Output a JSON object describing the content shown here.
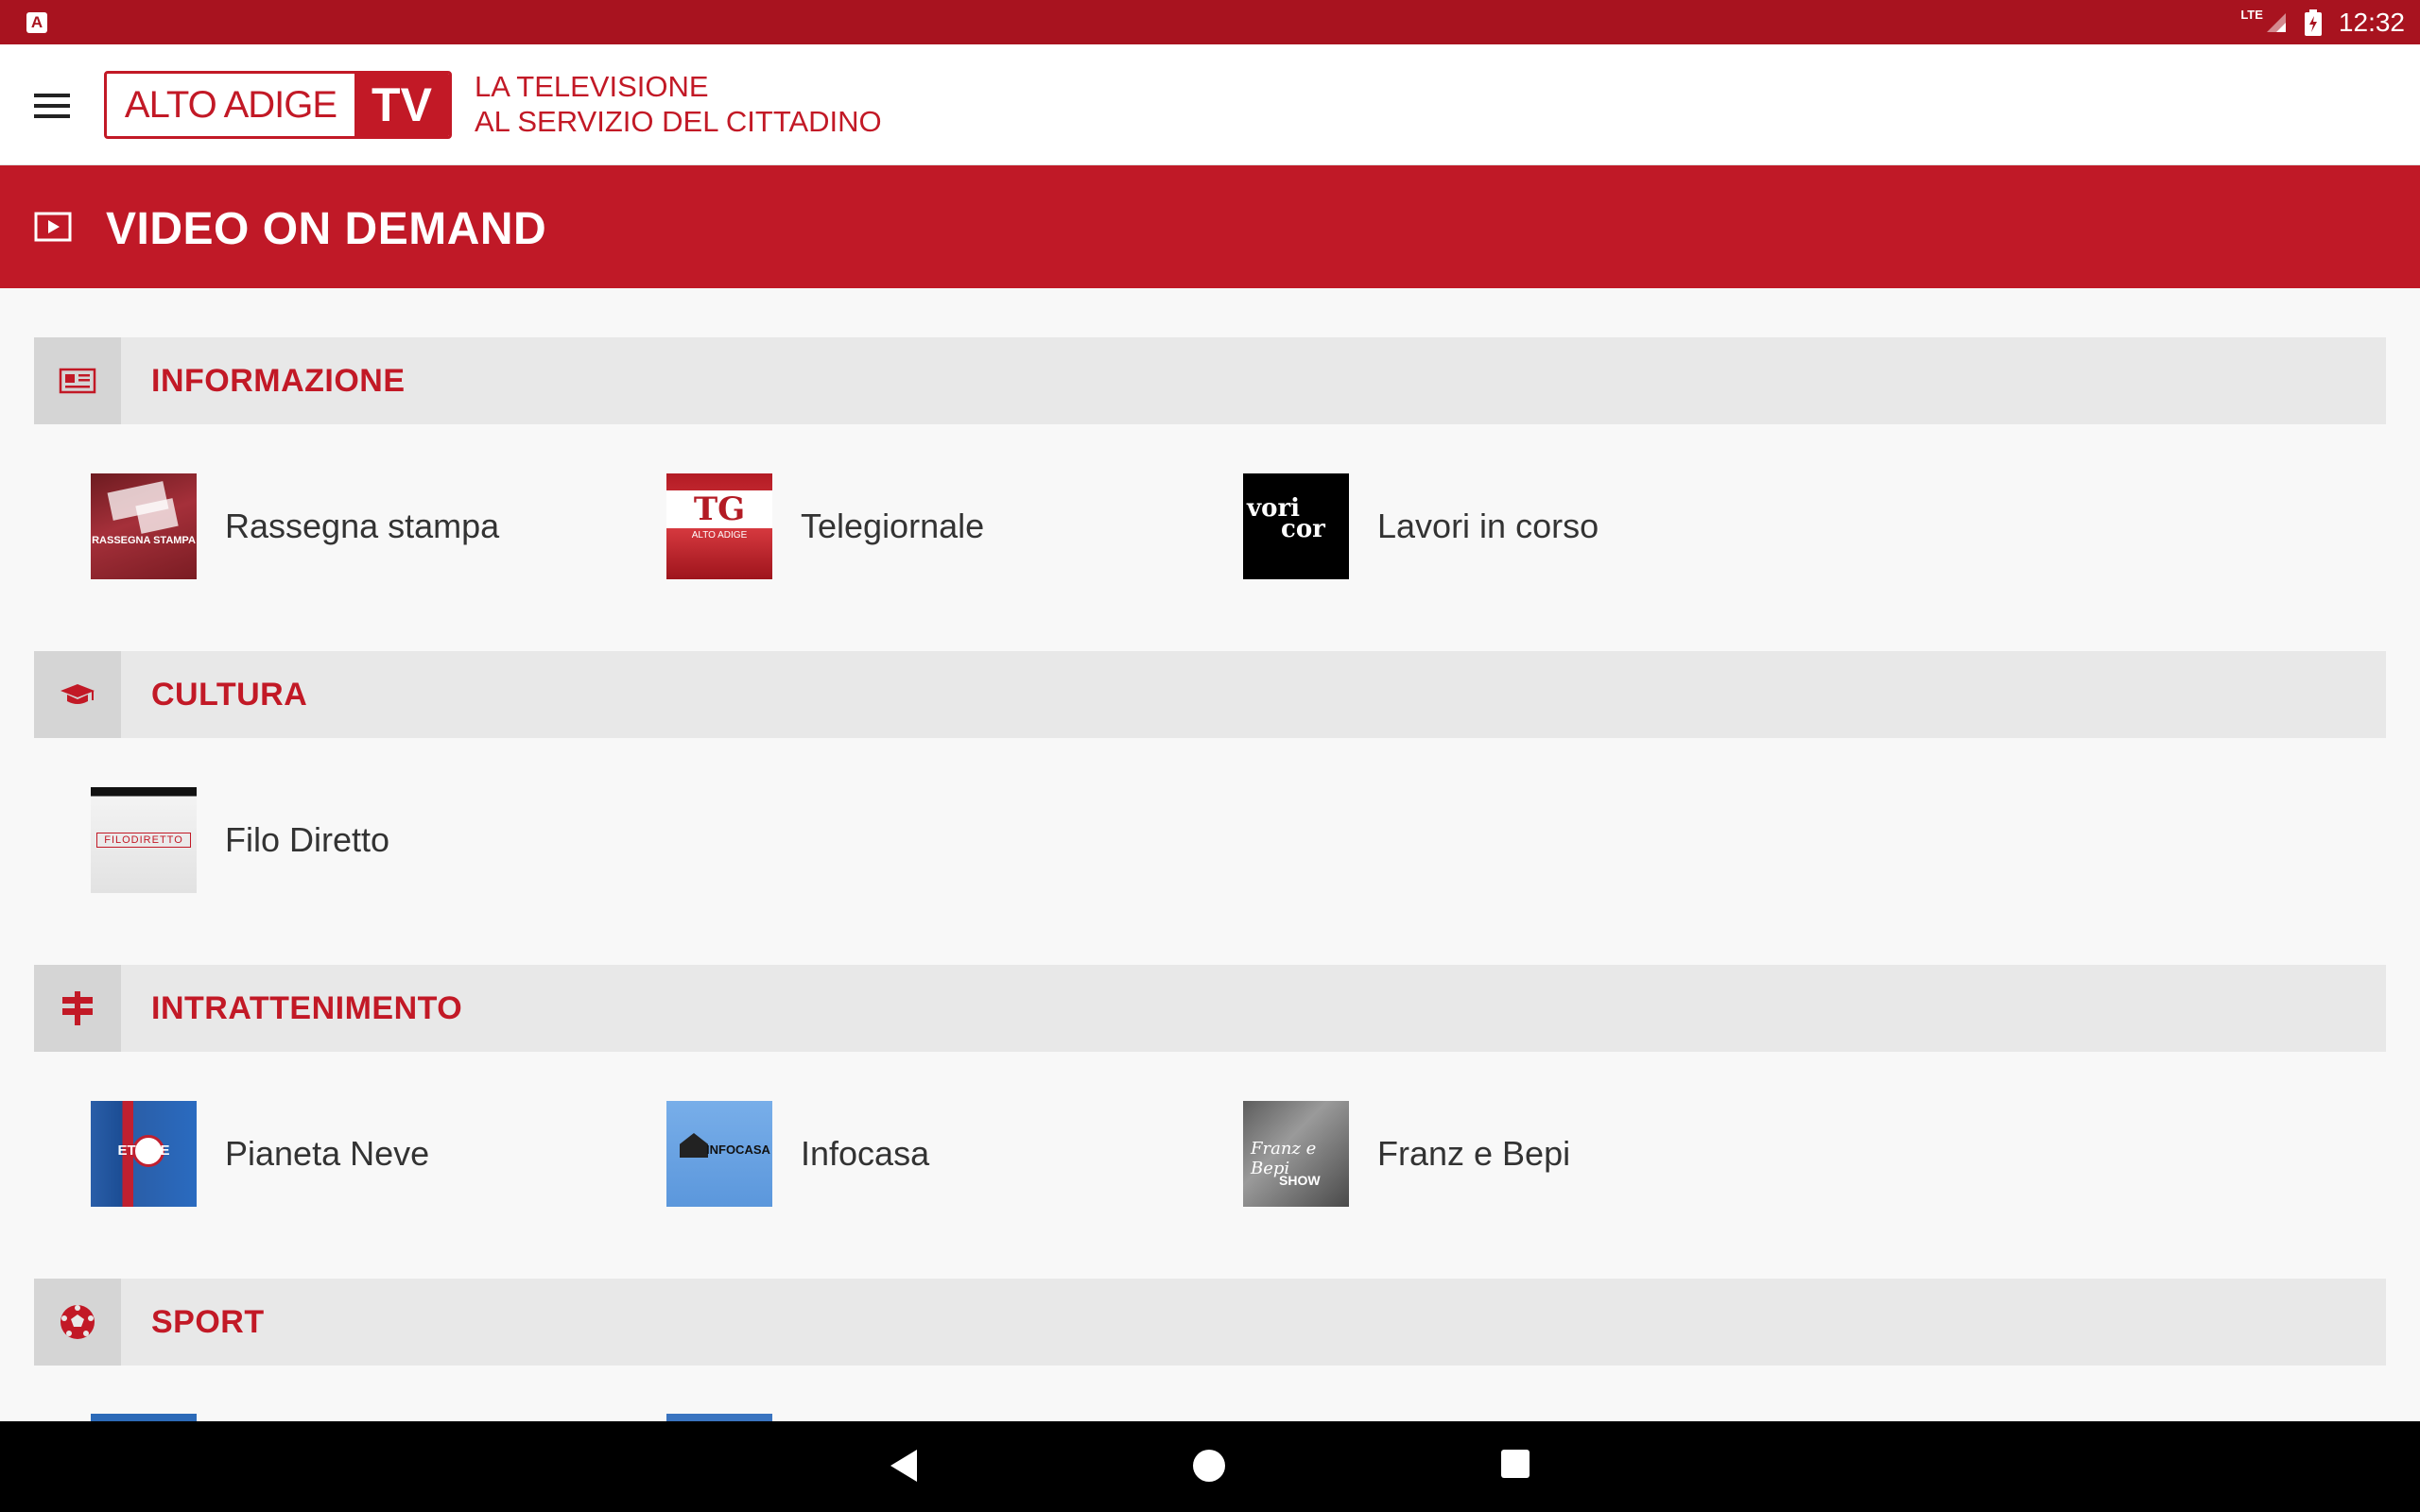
{
  "status_bar": {
    "network": "LTE",
    "time": "12:32"
  },
  "header": {
    "logo_left": "ALTO ADIGE",
    "logo_right": "TV",
    "tagline_line1": "LA TELEVISIONE",
    "tagline_line2": "AL SERVIZIO DEL CITTADINO"
  },
  "page": {
    "title": "VIDEO ON DEMAND"
  },
  "sections": [
    {
      "title": "INFORMAZIONE",
      "icon": "newspaper-icon",
      "items": [
        {
          "label": "Rassegna stampa",
          "thumb_text": "RASSEGNA STAMPA"
        },
        {
          "label": "Telegiornale",
          "thumb_text": "TG",
          "thumb_sub": "ALTO ADIGE"
        },
        {
          "label": "Lavori in corso",
          "thumb_text_1": "vori",
          "thumb_text_2": "cor"
        }
      ]
    },
    {
      "title": "CULTURA",
      "icon": "graduation-cap-icon",
      "items": [
        {
          "label": "Filo Diretto",
          "thumb_text": "FILODIRETTO"
        }
      ]
    },
    {
      "title": "INTRATTENIMENTO",
      "icon": "signpost-icon",
      "items": [
        {
          "label": "Pianeta Neve",
          "thumb_text": "ETR     NE"
        },
        {
          "label": "Infocasa",
          "thumb_text": "INFOCASA"
        },
        {
          "label": "Franz e Bepi",
          "thumb_text_1": "Franz e Bepi",
          "thumb_text_2": "SHOW"
        }
      ]
    },
    {
      "title": "SPORT",
      "icon": "soccer-ball-icon",
      "items": []
    }
  ],
  "colors": {
    "brand_red": "#c01927",
    "status_red": "#a8131f",
    "section_bg": "#e8e8e8"
  }
}
